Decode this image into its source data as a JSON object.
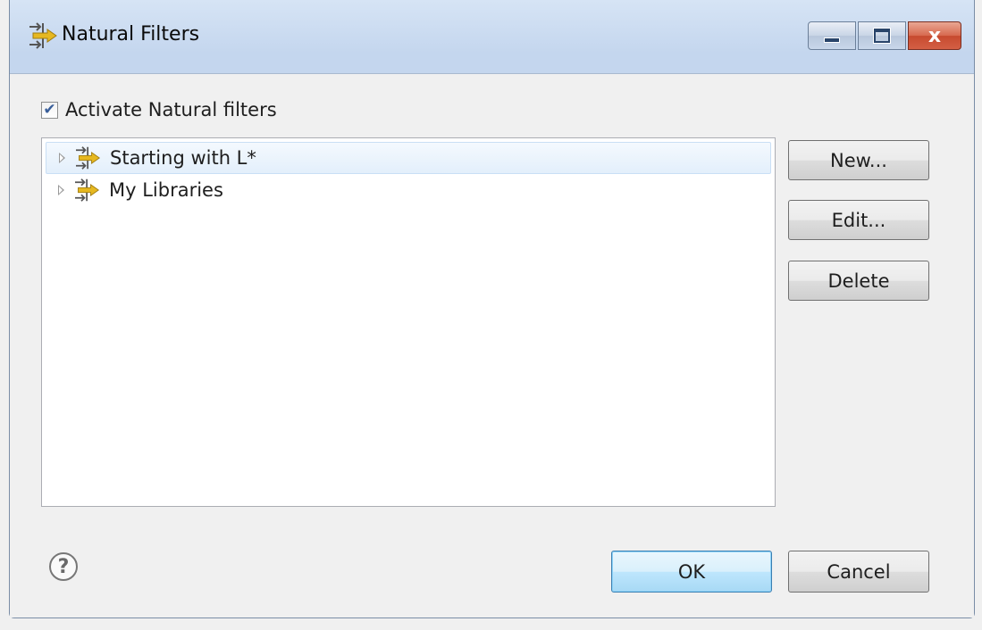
{
  "window": {
    "title": "Natural Filters",
    "icon": "filter-arrows-icon",
    "controls": {
      "minimize": "minimize-icon",
      "maximize": "maximize-icon",
      "close": "x"
    }
  },
  "activate": {
    "label": "Activate Natural filters",
    "checked": true,
    "check_glyph": "✔"
  },
  "filters": [
    {
      "label": "Starting with L*",
      "selected": true,
      "icon": "filter-arrows-icon"
    },
    {
      "label": "My Libraries",
      "selected": false,
      "icon": "filter-arrows-icon"
    }
  ],
  "side_buttons": {
    "new": "New...",
    "edit": "Edit...",
    "delete": "Delete"
  },
  "footer": {
    "help": "?",
    "ok": "OK",
    "cancel": "Cancel"
  },
  "colors": {
    "accent": "#3c7fb1",
    "selection": "#e3effb",
    "icon_yellow": "#e6b820"
  }
}
